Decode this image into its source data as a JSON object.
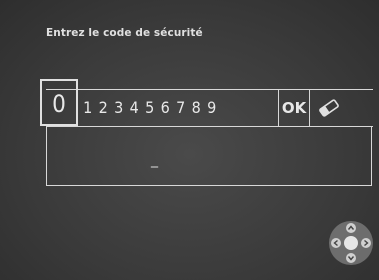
{
  "title": "Entrez le code de sécurité",
  "keypad": {
    "selected_digit": "0",
    "digits": [
      "1",
      "2",
      "3",
      "4",
      "5",
      "6",
      "7",
      "8",
      "9"
    ],
    "ok_label": "OK",
    "erase_icon": "eraser-icon"
  },
  "entry": {
    "value": "_"
  },
  "remote": {
    "icon": "dpad-icon"
  }
}
